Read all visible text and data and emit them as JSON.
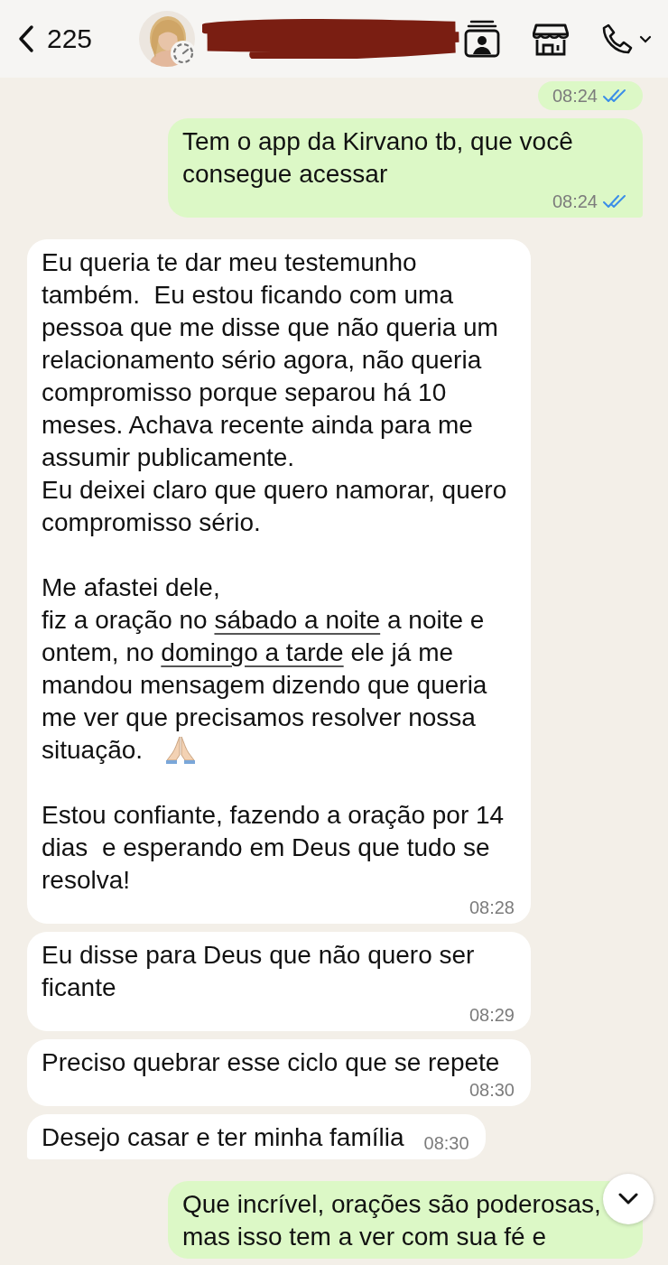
{
  "header": {
    "back_count": "225"
  },
  "messages": [
    {
      "kind": "outgoing",
      "time": "08:24",
      "read": true,
      "tail": false
    },
    {
      "kind": "outgoing",
      "parts": [
        {
          "kind": "plain",
          "text": "Tem o app da Kirvano tb, que você consegue acessar"
        }
      ],
      "time": "08:24",
      "read": true,
      "tail": true
    },
    {
      "kind": "incoming",
      "parts": [
        {
          "kind": "plain",
          "text": "Eu queria te dar meu testemunho também.  Eu estou ficando com uma pessoa que me disse que não queria um relacionamento sério agora, não queria compromisso porque separou há 10 meses. Achava recente ainda para me assumir publicamente.\nEu deixei claro que quero namorar, quero compromisso sério.\n\nMe afastei dele,\nfiz a oração no "
        },
        {
          "kind": "link",
          "text": "sábado a noite"
        },
        {
          "kind": "plain",
          "text": " a noite e ontem, no "
        },
        {
          "kind": "link",
          "text": "domingo a tarde"
        },
        {
          "kind": "plain",
          "text": " ele já me mandou mensagem dizendo que queria me ver que precisamos resolver nossa situação.  "
        },
        {
          "kind": "emoji"
        },
        {
          "kind": "plain",
          "text": "\n\nEstou confiante, fazendo a oração por 14 dias  e esperando em Deus que tudo se resolva!"
        }
      ],
      "time": "08:28",
      "tail": false
    },
    {
      "kind": "incoming",
      "parts": [
        {
          "kind": "plain",
          "text": "Eu disse para Deus que não quero ser ficante"
        }
      ],
      "time": "08:29",
      "tail": false
    },
    {
      "kind": "incoming",
      "parts": [
        {
          "kind": "plain",
          "text": "Preciso quebrar esse ciclo que se repete"
        }
      ],
      "time": "08:30",
      "tail": false
    },
    {
      "kind": "incoming",
      "parts": [
        {
          "kind": "plain",
          "text": "Desejo casar e ter minha família"
        }
      ],
      "time": "08:30",
      "tail": true
    },
    {
      "kind": "outgoing",
      "parts": [
        {
          "kind": "plain",
          "text": "Que incrível, orações são poderosas, mas isso tem a ver com sua fé e"
        }
      ],
      "tail": false
    }
  ]
}
